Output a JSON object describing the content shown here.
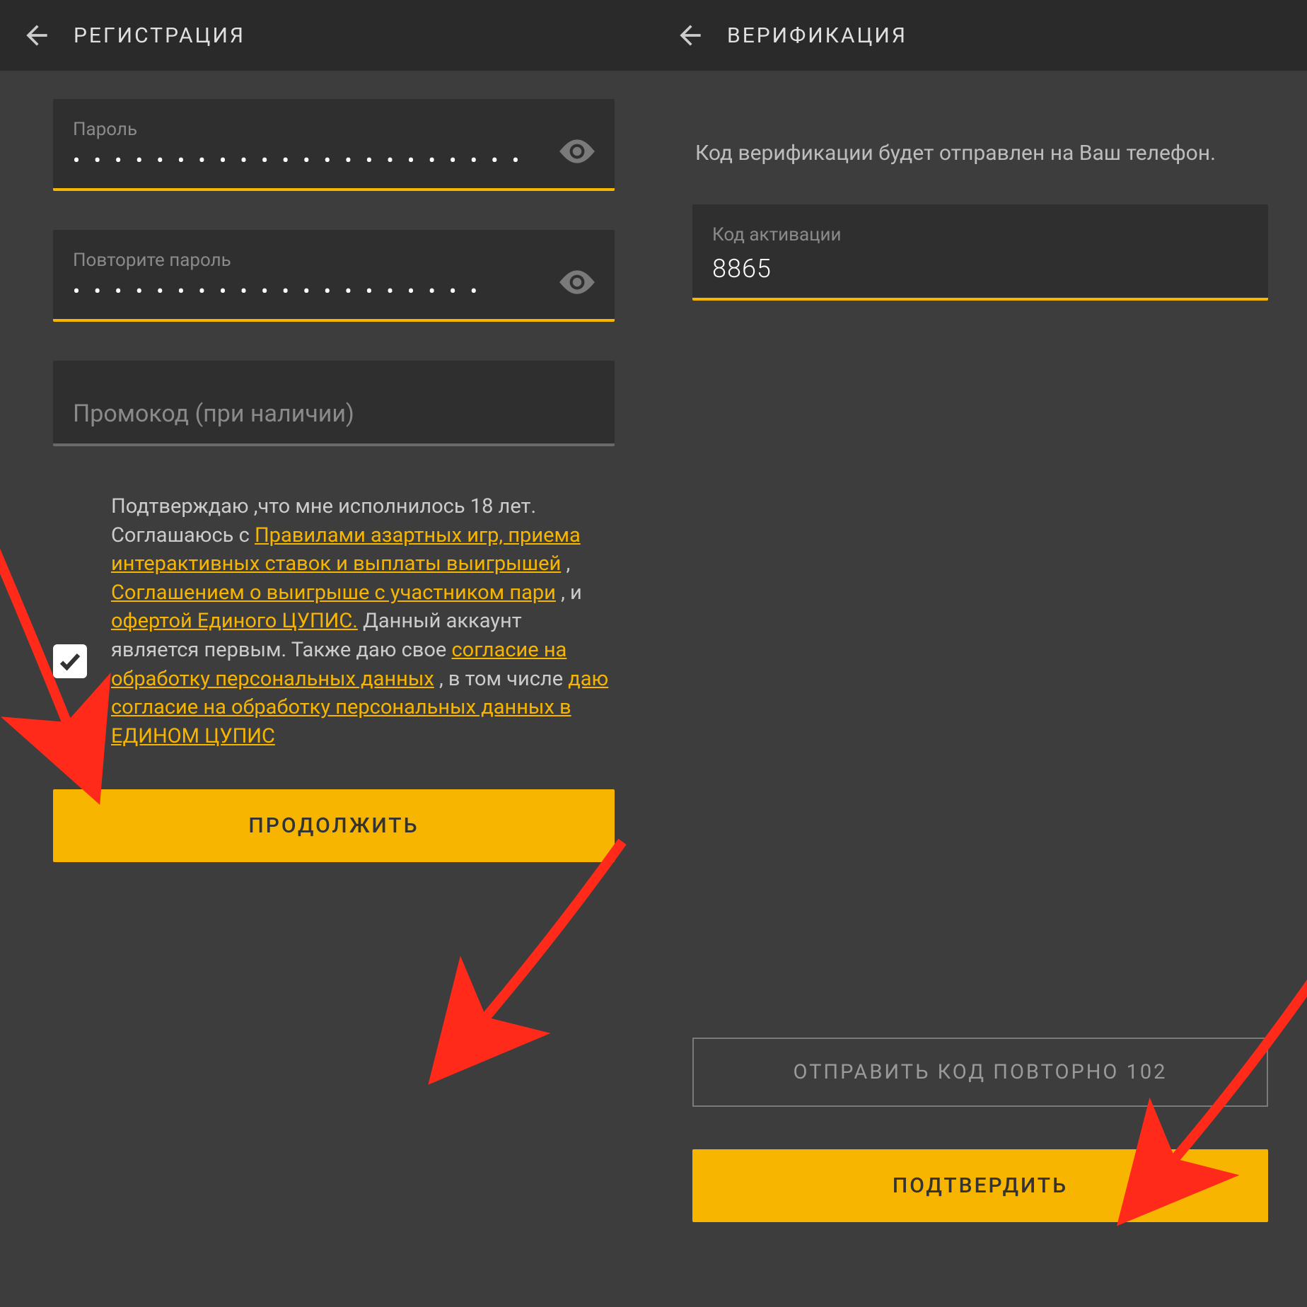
{
  "left": {
    "title": "РЕГИСТРАЦИЯ",
    "password": {
      "label": "Пароль",
      "value": "• • • • • • • • • • • • • • • • • • • • • •"
    },
    "repeat_password": {
      "label": "Повторите пароль",
      "value": "• • • • • • • • • • • • • • • • • • • •"
    },
    "promo_placeholder": "Промокод (при наличии)",
    "consent": {
      "t1": "Подтверждаю ,что мне исполнилось 18 лет. Соглашаюсь с ",
      "link1": "Правилами азартных игр, приема интерактивных ставок и выплаты выигрышей",
      "t2": " , ",
      "link2": "Соглашением о выигрыше с участником пари",
      "t3": " , и ",
      "link3": "офертой Единого ЦУПИС.",
      "t4": " Данный аккаунт является первым. Также даю свое ",
      "link4": "согласие на обработку персональных данных",
      "t5": " , в том числе ",
      "link5": "даю согласие на обработку персональных данных в ЕДИНОМ ЦУПИС"
    },
    "continue_btn": "ПРОДОЛЖИТЬ"
  },
  "right": {
    "title": "ВЕРИФИКАЦИЯ",
    "info": "Код верификации будет отправлен на Ваш телефон.",
    "code_label": "Код активации",
    "code_value": "8865",
    "resend_btn": "ОТПРАВИТЬ КОД ПОВТОРНО 102",
    "confirm_btn": "ПОДТВЕРДИТЬ"
  }
}
